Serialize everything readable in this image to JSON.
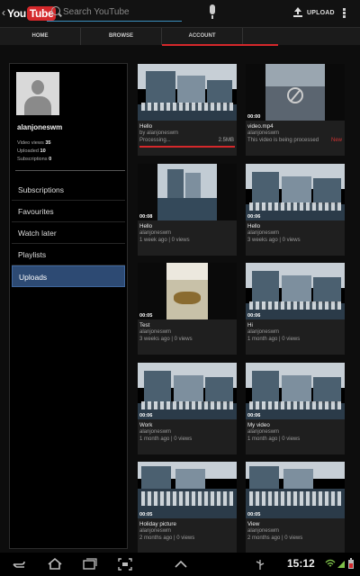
{
  "app": {
    "logo_you": "You",
    "logo_tube": "Tube",
    "back_glyph": "‹"
  },
  "search": {
    "placeholder": "Search YouTube"
  },
  "toolbar": {
    "upload_label": "UPLOAD"
  },
  "tabs": [
    {
      "label": "HOME"
    },
    {
      "label": "BROWSE"
    },
    {
      "label": "ACCOUNT",
      "active": true
    }
  ],
  "profile": {
    "username": "alanjoneswm",
    "video_views_label": "Video views",
    "video_views": "35",
    "uploaded_label": "Uploaded",
    "uploaded": "10",
    "subscriptions_label": "Subscriptions",
    "subscriptions": "0"
  },
  "sidebar": {
    "items": [
      {
        "label": "Subscriptions"
      },
      {
        "label": "Favourites"
      },
      {
        "label": "Watch later"
      },
      {
        "label": "Playlists"
      },
      {
        "label": "Uploads",
        "active": true
      }
    ]
  },
  "videos": [
    {
      "title": "Hello",
      "meta": "by alanjoneswm",
      "status": "Processing...",
      "size": "2.5MB",
      "duration": ""
    },
    {
      "title": "video.mp4",
      "meta": "alanjoneswm",
      "status": "This video is being processed",
      "badge": "New",
      "duration": "00:00"
    },
    {
      "title": "Hello",
      "meta": "alanjoneswm",
      "extra": "1 week ago | 0 views",
      "duration": "00:08"
    },
    {
      "title": "Hello",
      "meta": "alanjoneswm",
      "extra": "3 weeks ago | 0 views",
      "duration": "00:06"
    },
    {
      "title": "Test",
      "meta": "alanjoneswm",
      "extra": "3 weeks ago | 0 views",
      "duration": "00:05"
    },
    {
      "title": "Hi",
      "meta": "alanjoneswm",
      "extra": "1 month ago | 0 views",
      "duration": "00:06"
    },
    {
      "title": "Work",
      "meta": "alanjoneswm",
      "extra": "1 month ago | 0 views",
      "duration": "00:06"
    },
    {
      "title": "My video",
      "meta": "alanjoneswm",
      "extra": "1 month ago | 0 views",
      "duration": "00:06"
    },
    {
      "title": "Holiday picture",
      "meta": "alanjoneswm",
      "extra": "2 months ago | 0 views",
      "duration": "00:05"
    },
    {
      "title": "View",
      "meta": "alanjoneswm",
      "extra": "2 months ago | 0 views",
      "duration": "00:05"
    }
  ],
  "statusbar": {
    "time": "15:12"
  },
  "colors": {
    "accent": "#d4282b",
    "selected": "#2d4a73",
    "search_underline": "#3a8fbf"
  },
  "icons": [
    "back-icon",
    "search-icon",
    "mic-icon",
    "upload-icon",
    "more-icon",
    "avatar-icon",
    "no-video-icon",
    "home-nav-icon",
    "recent-apps-icon",
    "screenshot-icon",
    "menu-nav-icon",
    "usb-icon",
    "wifi-icon",
    "signal-icon",
    "battery-icon"
  ]
}
